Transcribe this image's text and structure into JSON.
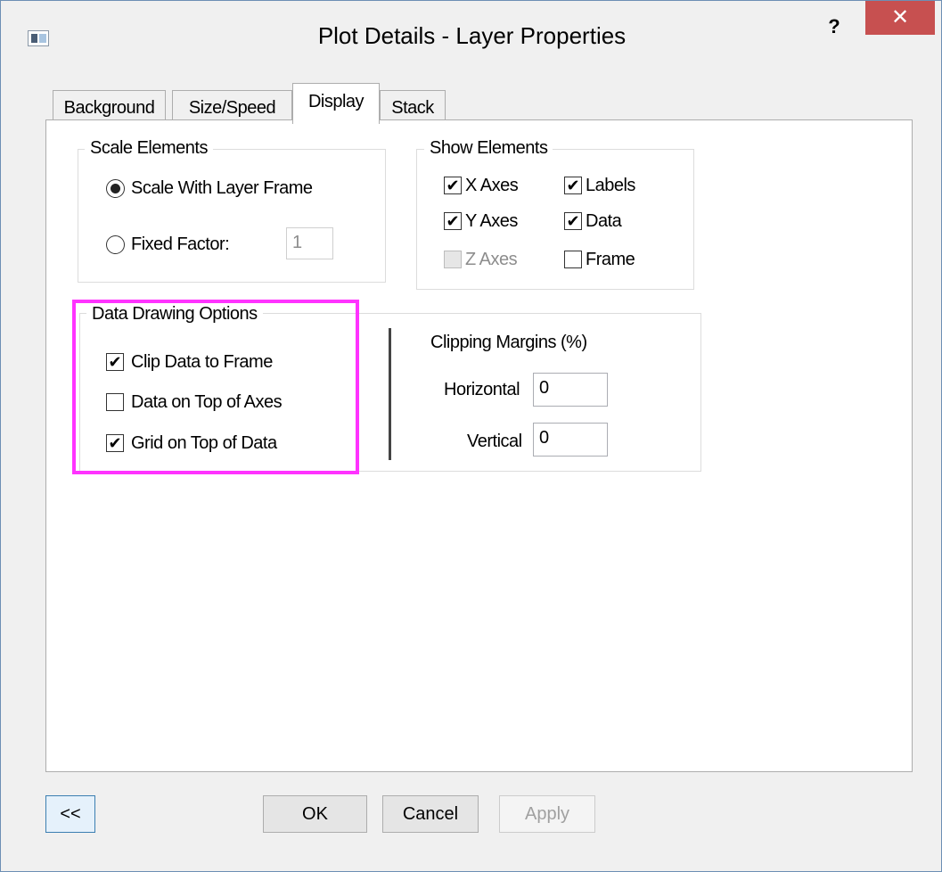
{
  "window": {
    "title": "Plot Details - Layer Properties",
    "help_label": "?",
    "close_label": "✕"
  },
  "tabs": [
    {
      "label": "Background",
      "active": false
    },
    {
      "label": "Size/Speed",
      "active": false
    },
    {
      "label": "Display",
      "active": true
    },
    {
      "label": "Stack",
      "active": false
    }
  ],
  "scale_elements": {
    "legend": "Scale Elements",
    "options": [
      {
        "label": "Scale With Layer Frame",
        "checked": true
      },
      {
        "label": "Fixed Factor:",
        "checked": false
      }
    ],
    "fixed_factor_value": "1"
  },
  "show_elements": {
    "legend": "Show Elements",
    "items": [
      {
        "label": "X Axes",
        "checked": true,
        "enabled": true
      },
      {
        "label": "Labels",
        "checked": true,
        "enabled": true
      },
      {
        "label": "Y Axes",
        "checked": true,
        "enabled": true
      },
      {
        "label": "Data",
        "checked": true,
        "enabled": true
      },
      {
        "label": "Z Axes",
        "checked": false,
        "enabled": false
      },
      {
        "label": "Frame",
        "checked": false,
        "enabled": true
      }
    ]
  },
  "data_drawing": {
    "legend": "Data Drawing Options",
    "options": [
      {
        "label": "Clip Data to Frame",
        "checked": true
      },
      {
        "label": "Data on Top of Axes",
        "checked": false
      },
      {
        "label": "Grid on Top of Data",
        "checked": true
      }
    ],
    "clipping_title": "Clipping Margins (%)",
    "horizontal_label": "Horizontal",
    "horizontal_value": "0",
    "vertical_label": "Vertical",
    "vertical_value": "0"
  },
  "buttons": {
    "collapse": "<<",
    "ok": "OK",
    "cancel": "Cancel",
    "apply": "Apply"
  },
  "colors": {
    "highlight": "#ff33ff",
    "close_button": "#c75050"
  }
}
